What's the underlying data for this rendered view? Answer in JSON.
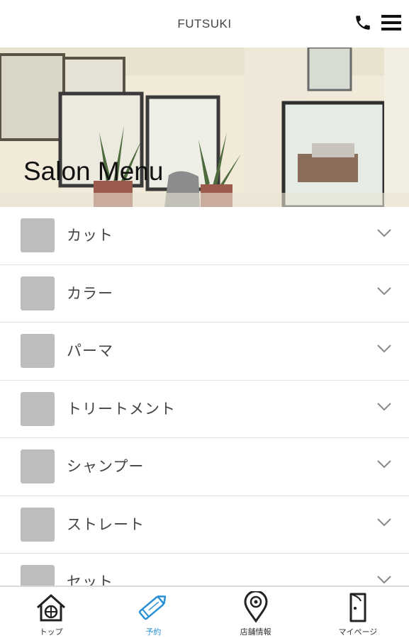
{
  "header": {
    "title": "FUTSUKI"
  },
  "hero": {
    "title": "Salon Menu"
  },
  "menu": {
    "items": [
      {
        "label": "カット"
      },
      {
        "label": "カラー"
      },
      {
        "label": "パーマ"
      },
      {
        "label": "トリートメント"
      },
      {
        "label": "シャンプー"
      },
      {
        "label": "ストレート"
      },
      {
        "label": "セット"
      }
    ]
  },
  "tabbar": {
    "tabs": [
      {
        "label": "トップ",
        "icon": "home-icon"
      },
      {
        "label": "予約",
        "icon": "pencil-icon"
      },
      {
        "label": "店舗情報",
        "icon": "map-pin-icon"
      },
      {
        "label": "マイページ",
        "icon": "door-icon"
      }
    ],
    "active_index": 1
  },
  "colors": {
    "accent": "#2a90d6",
    "thumb": "#bdbdbd",
    "divider": "#e2e2e2"
  }
}
